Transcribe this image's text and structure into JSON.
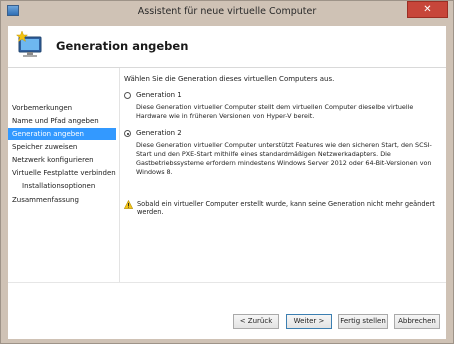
{
  "window": {
    "title": "Assistent für neue virtuelle Computer",
    "close_glyph": "✕"
  },
  "header": {
    "title": "Generation angeben",
    "icon": "computer-star-icon"
  },
  "sidebar": {
    "items": [
      {
        "label": "Vorbemerkungen",
        "active": false
      },
      {
        "label": "Name und Pfad angeben",
        "active": false
      },
      {
        "label": "Generation angeben",
        "active": true
      },
      {
        "label": "Speicher zuweisen",
        "active": false
      },
      {
        "label": "Netzwerk konfigurieren",
        "active": false
      },
      {
        "label": "Virtuelle Festplatte verbinden",
        "active": false
      },
      {
        "label": "Installationsoptionen",
        "active": false,
        "sub": true
      },
      {
        "label": "Zusammenfassung",
        "active": false
      }
    ]
  },
  "main": {
    "intro": "Wählen Sie die Generation dieses virtuellen Computers aus.",
    "options": [
      {
        "label": "Generation 1",
        "checked": false,
        "description": "Diese Generation virtueller Computer stellt dem virtuellen Computer dieselbe virtuelle Hardware wie in früheren Versionen von Hyper-V bereit."
      },
      {
        "label": "Generation 2",
        "checked": true,
        "description": "Diese Generation virtueller Computer unterstützt Features wie den sicheren Start, den SCSI-Start und den PXE-Start mithilfe eines standardmäßigen Netzwerkadapters. Die Gastbetriebssysteme erfordern mindestens Windows Server 2012 oder 64-Bit-Versionen von Windows 8."
      }
    ],
    "warning": "Sobald ein virtueller Computer erstellt wurde, kann seine Generation nicht mehr geändert werden."
  },
  "buttons": {
    "back": "< Zurück",
    "next": "Weiter >",
    "finish": "Fertig stellen",
    "cancel": "Abbrechen"
  },
  "colors": {
    "accent": "#3399ff",
    "titlebar": "#cfc2b5",
    "close": "#c7463a"
  }
}
